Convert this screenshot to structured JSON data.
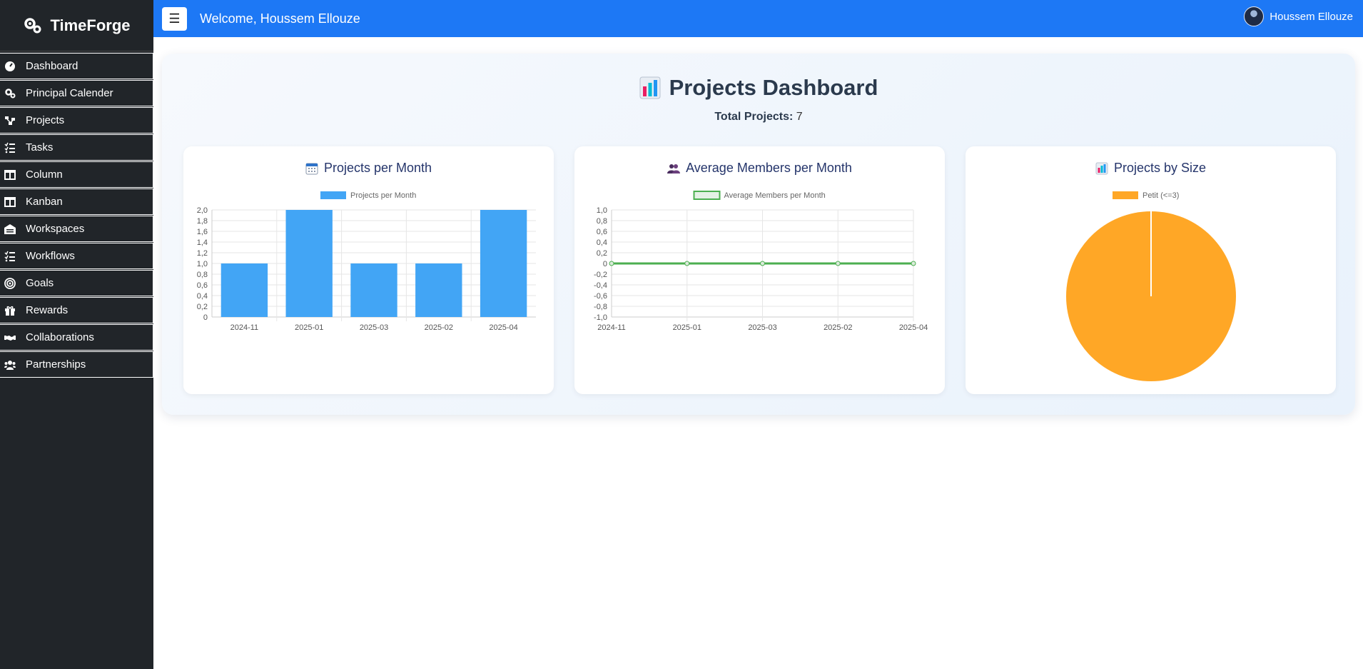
{
  "brand": {
    "name": "TimeForge"
  },
  "topbar": {
    "welcome": "Welcome, Houssem Ellouze",
    "user_name": "Houssem Ellouze",
    "menu_icon": "hamburger-icon"
  },
  "sidebar": {
    "items": [
      {
        "label": "Dashboard",
        "icon": "tachometer-icon"
      },
      {
        "label": "Principal Calender",
        "icon": "cogs-icon"
      },
      {
        "label": "Projects",
        "icon": "project-diagram-icon"
      },
      {
        "label": "Tasks",
        "icon": "tasks-icon"
      },
      {
        "label": "Column",
        "icon": "columns-icon"
      },
      {
        "label": "Kanban",
        "icon": "kanban-icon"
      },
      {
        "label": "Workspaces",
        "icon": "warehouse-icon"
      },
      {
        "label": "Workflows",
        "icon": "workflow-icon"
      },
      {
        "label": "Goals",
        "icon": "target-icon"
      },
      {
        "label": "Rewards",
        "icon": "gift-icon"
      },
      {
        "label": "Collaborations",
        "icon": "handshake-icon"
      },
      {
        "label": "Partnerships",
        "icon": "users-icon"
      }
    ]
  },
  "dashboard": {
    "title": "Projects Dashboard",
    "total_label": "Total Projects:",
    "total_value": "7"
  },
  "cards": {
    "per_month_title": "Projects per Month",
    "avg_members_title": "Average Members per Month",
    "by_size_title": "Projects by Size"
  },
  "chart_data": [
    {
      "type": "bar",
      "title": "Projects per Month",
      "categories": [
        "2024-11",
        "2025-01",
        "2025-03",
        "2025-02",
        "2025-04"
      ],
      "series": [
        {
          "name": "Projects per Month",
          "values": [
            1,
            2,
            1,
            1,
            2
          ],
          "color": "#42a5f5"
        }
      ],
      "ylim": [
        0,
        2
      ],
      "yticks": [
        "0",
        "0,2",
        "0,4",
        "0,6",
        "0,8",
        "1,0",
        "1,2",
        "1,4",
        "1,6",
        "1,8",
        "2,0"
      ],
      "grid": true,
      "legend": "top"
    },
    {
      "type": "line",
      "title": "Average Members per Month",
      "categories": [
        "2024-11",
        "2025-01",
        "2025-03",
        "2025-02",
        "2025-04"
      ],
      "series": [
        {
          "name": "Average Members per Month",
          "values": [
            0,
            0,
            0,
            0,
            0
          ],
          "color": "#4caf50"
        }
      ],
      "ylim": [
        -1,
        1
      ],
      "yticks": [
        "-1,0",
        "-0,8",
        "-0,6",
        "-0,4",
        "-0,2",
        "0",
        "0,2",
        "0,4",
        "0,6",
        "0,8",
        "1,0"
      ],
      "grid": true,
      "legend": "top"
    },
    {
      "type": "pie",
      "title": "Projects by Size",
      "labels": [
        "Petit (<=3)"
      ],
      "values": [
        7
      ],
      "colors": [
        "#ffa726"
      ],
      "legend": "top"
    }
  ]
}
